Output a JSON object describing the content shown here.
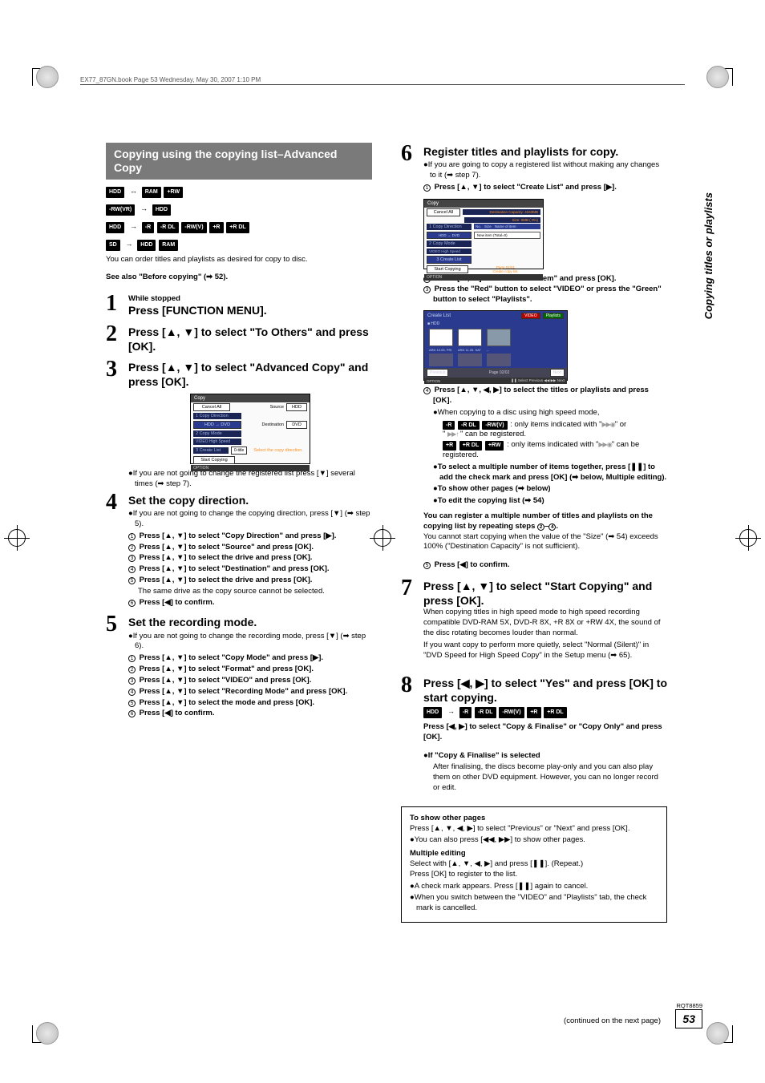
{
  "header_line": "EX77_87GN.book  Page 53  Wednesday, May 30, 2007  1:10 PM",
  "sidebar": "Copying titles or playlists",
  "section_title": "Copying using the copying list–Advanced Copy",
  "media_lines": {
    "l1a": "HDD",
    "l1b": "RAM",
    "l1c": "+RW",
    "l2a": "-RW(VR)",
    "l2b": "HDD",
    "l3a": "HDD",
    "l3b": "-R",
    "l3c": "-R DL",
    "l3d": "-RW(V)",
    "l3e": "+R",
    "l3f": "+R DL",
    "l4a": "SD",
    "l4b": "HDD",
    "l4c": "RAM"
  },
  "intro": "You can order titles and playlists as desired for copy to disc.",
  "see_also": "See also \"Before copying\" (➡ 52).",
  "steps": {
    "s1_small": "While stopped",
    "s1_head": "Press [FUNCTION MENU].",
    "s2_head": "Press [▲, ▼] to select \"To Others\" and press [OK].",
    "s3_head": "Press [▲, ▼] to select \"Advanced Copy\" and press [OK].",
    "s3_note": "●If you are not going to change the registered list press [▼] several times (➡ step 7).",
    "s4_head": "Set the copy direction.",
    "s4_note": "●If you are not going to change the copying direction, press [▼] (➡ step 5).",
    "s4_1": "Press [▲, ▼] to select \"Copy Direction\" and press [▶].",
    "s4_2": "Press [▲, ▼] to select \"Source\" and press [OK].",
    "s4_3": "Press [▲, ▼] to select the drive and press [OK].",
    "s4_4": "Press [▲, ▼] to select \"Destination\" and press [OK].",
    "s4_5": "Press [▲, ▼] to select the drive and press [OK].",
    "s4_5b": "The same drive as the copy source cannot be selected.",
    "s4_6": "Press [◀] to confirm.",
    "s5_head": "Set the recording mode.",
    "s5_note": "●If you are not going to change the recording mode, press [▼] (➡ step 6).",
    "s5_1": "Press [▲, ▼] to select \"Copy Mode\" and press [▶].",
    "s5_2": "Press [▲, ▼] to select \"Format\" and press [OK].",
    "s5_3": "Press [▲, ▼] to select \"VIDEO\" and press [OK].",
    "s5_4": "Press [▲, ▼] to select \"Recording Mode\" and press [OK].",
    "s5_5": "Press [▲, ▼] to select the mode and press [OK].",
    "s5_6": "Press [◀] to confirm.",
    "s6_head": "Register titles and playlists for copy.",
    "s6_note": "●If you are going to copy a registered list without making any changes to it (➡ step 7).",
    "s6_1": "Press [▲, ▼] to select \"Create List\" and press [▶].",
    "s6_2": "Press [▲, ▼] to select \"New item\" and press [OK].",
    "s6_3": "Press the \"Red\" button to select \"VIDEO\" or press the \"Green\" button to select \"Playlists\".",
    "s6_4": "Press [▲, ▼, ◀, ▶] to select the titles or playlists and press [OK].",
    "s6_4a": "●When copying to a disc using high speed mode,",
    "s6_4b1": "-R",
    "s6_4b2": "-R DL",
    "s6_4b3": "-RW(V)",
    "s6_4b_txt": " : only items indicated with \"",
    "s6_4b_end": "\" or",
    "s6_4c": "\" can be registered.",
    "s6_4d1": "+R",
    "s6_4d2": "+R DL",
    "s6_4d3": "+RW",
    "s6_4d_txt": " : only items indicated with \"",
    "s6_4d_end": "\" can be registered.",
    "s6_4e": "●To select a multiple number of items together, press [❚❚] to add the check mark and press [OK] (➡ below, Multiple editing).",
    "s6_4f": "●To show other pages (➡ below)",
    "s6_4g": "●To edit the copying list (➡ 54)",
    "s6_reg": "You can register a multiple number of titles and playlists on the copying list by repeating steps ",
    "s6_reg2": "–",
    "s6_reg3": ".",
    "s6_reg_body": "You cannot start copying when the value of the \"Size\" (➡ 54) exceeds 100% (\"Destination Capacity\" is not sufficient).",
    "s6_5": "Press [◀] to confirm.",
    "s7_head": "Press [▲, ▼] to select \"Start Copying\" and press [OK].",
    "s7_body1": "When copying titles in high speed mode to high speed recording compatible DVD-RAM 5X, DVD-R 8X, +R 8X or +RW 4X, the sound of the disc rotating becomes louder than normal.",
    "s7_body2": "If you want copy to perform more quietly, select \"Normal (Silent)\" in \"DVD Speed for High Speed Copy\" in the Setup menu (➡ 65).",
    "s8_head": "Press [◀, ▶] to select \"Yes\" and press [OK] to start copying.",
    "s8_m1": "HDD",
    "s8_m2": "-R",
    "s8_m3": "-R DL",
    "s8_m4": "-RW(V)",
    "s8_m5": "+R",
    "s8_m6": "+R DL",
    "s8_sub": "Press [◀, ▶] to select \"Copy & Finalise\" or \"Copy Only\" and press [OK].",
    "s8_if": "●If \"Copy & Finalise\" is selected",
    "s8_ifbody": "After finalising, the discs become play-only and you can also play them on other DVD equipment. However, you can no longer record or edit."
  },
  "screenshot1": {
    "title": "Copy",
    "cancel": "Cancel All",
    "row1": "1 Copy Direction",
    "row1sub": "HDD → DVD",
    "row2": "2 Copy Mode",
    "row2sub": "VIDEO  High Speed",
    "row3": "3 Create List",
    "row3sub": "0-title",
    "start": "Start Copying",
    "source_lbl": "Source",
    "source_val": "HDD",
    "dest_lbl": "Destination",
    "dest_val": "DVD",
    "hint": "Select the copy direction.",
    "option": "OPTION"
  },
  "screenshot2": {
    "title": "Copy",
    "cancel": "Cancel All",
    "dest_cap": "Destination Capacity: 4343MB",
    "size": "Size:",
    "pct": "0MB ( 0%)",
    "hdr_no": "No.",
    "hdr_size": "Size",
    "hdr_name": "Name of item",
    "newitem": "New item (Total=0)",
    "row1": "1 Copy Direction",
    "row1s": "HDD → DVD",
    "row2": "2 Copy Mode",
    "row2s": "VIDEO  High Speed",
    "row3": "3 Create List",
    "start": "Start Copying",
    "hint1": "Page 01/01",
    "hint2": "Create copy list.",
    "option": "OPTION"
  },
  "screenshot3": {
    "title": "Create List",
    "hdd": "■ HDD",
    "tab1": "VIDEO",
    "tab2": "Playlists",
    "th1": "ARD 10.05. PRI",
    "th2": "ARD 11.05. SAT",
    "prev": "Previous",
    "page": "Page 02/02",
    "next": "Next",
    "option": "OPTION",
    "footer": "❚❚ Select   Previous ◀◀ ▶▶ Next"
  },
  "notebox": {
    "h1": "To show other pages",
    "b1": "Press [▲, ▼, ◀, ▶] to select \"Previous\" or \"Next\" and press [OK].",
    "b2": "●You can also press [◀◀, ▶▶] to show other pages.",
    "h2": "Multiple editing",
    "b3": "Select with [▲, ▼, ◀, ▶] and press [❚❚]. (Repeat.)",
    "b4": "Press [OK] to register to the list.",
    "b5": "●A check mark appears. Press [❚❚] again to cancel.",
    "b6": "●When you switch between the \"VIDEO\" and \"Playlists\" tab, the check mark is cancelled."
  },
  "continued": "(continued on the next page)",
  "rqt": "RQT8859",
  "page_num": "53"
}
